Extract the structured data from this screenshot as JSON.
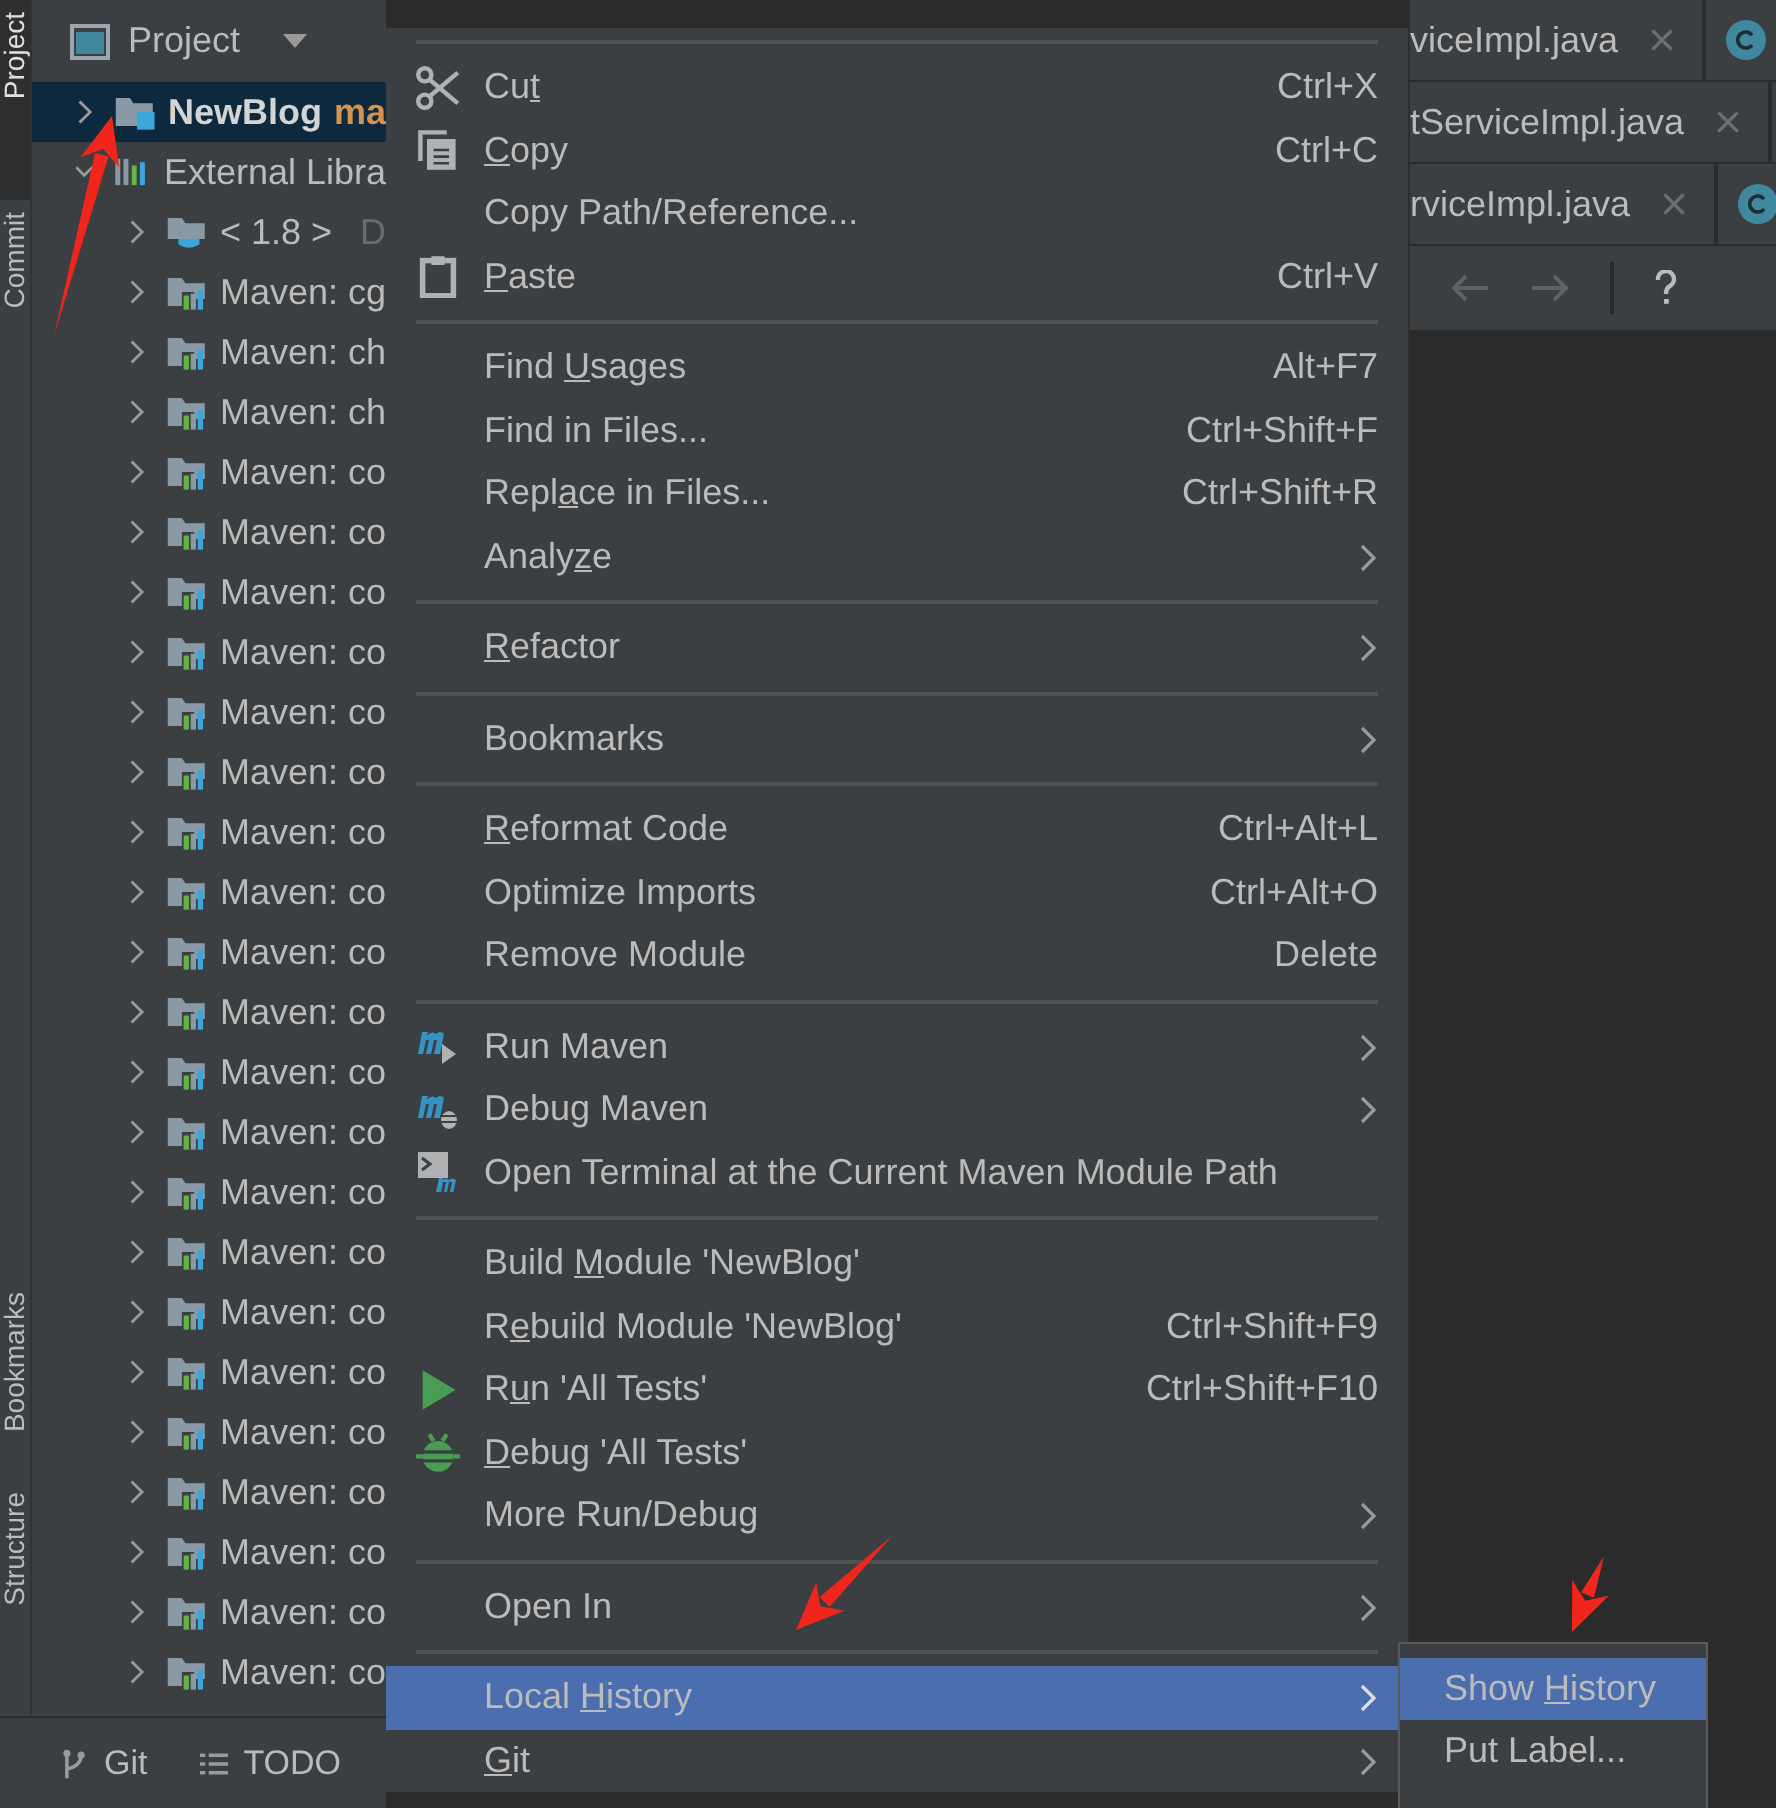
{
  "tool_stripe": {
    "top": [
      {
        "label": "Project",
        "selected": true
      },
      {
        "label": "Commit",
        "selected": false
      }
    ],
    "bottom": [
      {
        "label": "Bookmarks",
        "selected": false
      },
      {
        "label": "Structure",
        "selected": false
      }
    ]
  },
  "project_panel": {
    "title": "Project",
    "tree": [
      {
        "label": "NewBlog",
        "suffix": "ma",
        "kind": "module",
        "selected": true,
        "expanded": false
      },
      {
        "label": "External Libra",
        "kind": "libraries",
        "selected": false,
        "expanded": true,
        "children": [
          {
            "label": "< 1.8 >",
            "suffix": "D",
            "kind": "jdk",
            "selected": false,
            "expanded": false
          },
          {
            "label": "Maven: cg",
            "kind": "maven",
            "selected": false,
            "expanded": false
          },
          {
            "label": "Maven: ch",
            "kind": "maven",
            "selected": false,
            "expanded": false
          },
          {
            "label": "Maven: ch",
            "kind": "maven",
            "selected": false,
            "expanded": false
          },
          {
            "label": "Maven: co",
            "kind": "maven",
            "selected": false,
            "expanded": false
          },
          {
            "label": "Maven: co",
            "kind": "maven",
            "selected": false,
            "expanded": false
          },
          {
            "label": "Maven: co",
            "kind": "maven",
            "selected": false,
            "expanded": false
          },
          {
            "label": "Maven: co",
            "kind": "maven",
            "selected": false,
            "expanded": false
          },
          {
            "label": "Maven: co",
            "kind": "maven",
            "selected": false,
            "expanded": false
          },
          {
            "label": "Maven: co",
            "kind": "maven",
            "selected": false,
            "expanded": false
          },
          {
            "label": "Maven: co",
            "kind": "maven",
            "selected": false,
            "expanded": false
          },
          {
            "label": "Maven: co",
            "kind": "maven",
            "selected": false,
            "expanded": false
          },
          {
            "label": "Maven: co",
            "kind": "maven",
            "selected": false,
            "expanded": false
          },
          {
            "label": "Maven: co",
            "kind": "maven",
            "selected": false,
            "expanded": false
          },
          {
            "label": "Maven: co",
            "kind": "maven",
            "selected": false,
            "expanded": false
          },
          {
            "label": "Maven: co",
            "kind": "maven",
            "selected": false,
            "expanded": false
          },
          {
            "label": "Maven: co",
            "kind": "maven",
            "selected": false,
            "expanded": false
          },
          {
            "label": "Maven: co",
            "kind": "maven",
            "selected": false,
            "expanded": false
          },
          {
            "label": "Maven: co",
            "kind": "maven",
            "selected": false,
            "expanded": false
          },
          {
            "label": "Maven: co",
            "kind": "maven",
            "selected": false,
            "expanded": false
          },
          {
            "label": "Maven: co",
            "kind": "maven",
            "selected": false,
            "expanded": false
          },
          {
            "label": "Maven: co",
            "kind": "maven",
            "selected": false,
            "expanded": false
          },
          {
            "label": "Maven: co",
            "kind": "maven",
            "selected": false,
            "expanded": false
          },
          {
            "label": "Maven: co",
            "kind": "maven",
            "selected": false,
            "expanded": false
          },
          {
            "label": "Maven: co",
            "kind": "maven",
            "selected": false,
            "expanded": false
          }
        ]
      }
    ]
  },
  "bottom_toolbar": [
    {
      "label": "Git",
      "kind": "git"
    },
    {
      "label": "TODO",
      "kind": "todo"
    }
  ],
  "editor": {
    "tab_rows": [
      [
        {
          "kind": "file",
          "label": "viceImpl.java"
        },
        {
          "kind": "class"
        }
      ],
      [
        {
          "kind": "file",
          "label": "tServiceImpl.java"
        }
      ],
      [
        {
          "kind": "file",
          "label": "rviceImpl.java"
        },
        {
          "kind": "class"
        }
      ]
    ]
  },
  "context_menu": {
    "items": [
      {
        "kind": "separator"
      },
      {
        "kind": "cut",
        "label": {
          "pre": "Cu",
          "key": "t"
        },
        "shortcut": "Ctrl+X",
        "selected": false
      },
      {
        "kind": "copy",
        "label": {
          "key": "C",
          "post": "opy"
        },
        "shortcut": "Ctrl+C",
        "selected": false
      },
      {
        "kind": "item",
        "label": "Copy Path/Reference...",
        "selected": false
      },
      {
        "kind": "paste",
        "label": {
          "key": "P",
          "post": "aste"
        },
        "shortcut": "Ctrl+V",
        "selected": false
      },
      {
        "kind": "separator"
      },
      {
        "kind": "item",
        "label": {
          "pre": "Find ",
          "key": "U",
          "post": "sages"
        },
        "shortcut": "Alt+F7",
        "selected": false
      },
      {
        "kind": "item",
        "label": "Find in Files...",
        "shortcut": "Ctrl+Shift+F",
        "selected": false
      },
      {
        "kind": "item",
        "label": {
          "pre": "Repl",
          "key": "a",
          "post": "ce in Files..."
        },
        "shortcut": "Ctrl+Shift+R",
        "selected": false
      },
      {
        "kind": "item",
        "label": {
          "pre": "Analy",
          "key": "z",
          "post": "e"
        },
        "submenu": true,
        "selected": false
      },
      {
        "kind": "separator"
      },
      {
        "kind": "item",
        "label": {
          "key": "R",
          "post": "efactor"
        },
        "submenu": true,
        "selected": false
      },
      {
        "kind": "separator"
      },
      {
        "kind": "item",
        "label": "Bookmarks",
        "submenu": true,
        "selected": false
      },
      {
        "kind": "separator"
      },
      {
        "kind": "item",
        "label": {
          "key": "R",
          "post": "eformat Code"
        },
        "shortcut": "Ctrl+Alt+L",
        "selected": false
      },
      {
        "kind": "item",
        "label": "Optimize Imports",
        "shortcut": "Ctrl+Alt+O",
        "selected": false
      },
      {
        "kind": "item",
        "label": "Remove Module",
        "shortcut": "Delete",
        "selected": false
      },
      {
        "kind": "separator"
      },
      {
        "kind": "run-maven",
        "label": "Run Maven",
        "submenu": true,
        "selected": false
      },
      {
        "kind": "debug-maven",
        "label": "Debug Maven",
        "submenu": true,
        "selected": false
      },
      {
        "kind": "terminal",
        "label": "Open Terminal at the Current Maven Module Path",
        "selected": false
      },
      {
        "kind": "separator"
      },
      {
        "kind": "item",
        "label": {
          "pre": "Build ",
          "key": "M",
          "post": "odule 'NewBlog'"
        },
        "selected": false
      },
      {
        "kind": "item",
        "label": {
          "pre": "R",
          "key": "e",
          "post": "build Module 'NewBlog'"
        },
        "shortcut": "Ctrl+Shift+F9",
        "selected": false
      },
      {
        "kind": "run",
        "label": {
          "pre": "R",
          "key": "u",
          "post": "n 'All Tests'"
        },
        "shortcut": "Ctrl+Shift+F10",
        "selected": false
      },
      {
        "kind": "debug",
        "label": {
          "key": "D",
          "post": "ebug 'All Tests'"
        },
        "selected": false
      },
      {
        "kind": "item",
        "label": "More Run/Debug",
        "submenu": true,
        "selected": false
      },
      {
        "kind": "separator"
      },
      {
        "kind": "item",
        "label": "Open In",
        "submenu": true,
        "selected": false
      },
      {
        "kind": "separator"
      },
      {
        "kind": "item",
        "label": {
          "pre": "Local ",
          "key": "H",
          "post": "istory"
        },
        "submenu": true,
        "selected": true
      },
      {
        "kind": "item",
        "label": {
          "key": "G",
          "post": "it"
        },
        "submenu": true,
        "selected": false
      }
    ]
  },
  "submenu": {
    "items": [
      {
        "label": {
          "pre": "Show ",
          "key": "H",
          "post": "istory"
        },
        "selected": true
      },
      {
        "label": "Put Label...",
        "selected": false
      }
    ]
  }
}
